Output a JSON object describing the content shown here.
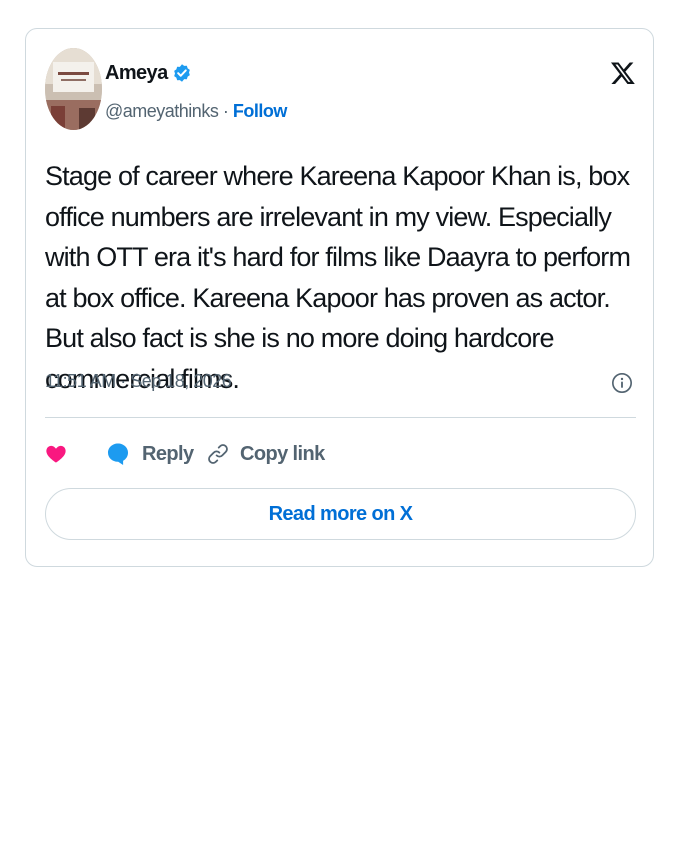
{
  "tweet": {
    "author_name": "Ameya",
    "author_handle": "@ameyathinks",
    "separator": "·",
    "follow_label": "Follow",
    "text": "Stage of career where Kareena Kapoor Khan is, box office numbers are irrelevant in my view. Especially with OTT era it's hard for films like Daayra to perform at box office. Kareena Kapoor has proven as actor. But also fact is she is no more doing hardcore commercial films.",
    "timestamp": "11:51 AM · Sep 18, 2026"
  },
  "actions": {
    "reply_label": "Reply",
    "copy_link_label": "Copy link"
  },
  "read_more_label": "Read more on X",
  "icons": {
    "verified": "verified-badge-icon",
    "platform": "x-logo-icon",
    "info": "info-icon",
    "like": "heart-icon",
    "reply": "speech-bubble-icon",
    "copy": "link-icon"
  },
  "colors": {
    "accent": "#006fd6",
    "verified": "#1d9bf0",
    "like": "#f91880",
    "border": "#cfd9de",
    "secondary_text": "#536471"
  }
}
